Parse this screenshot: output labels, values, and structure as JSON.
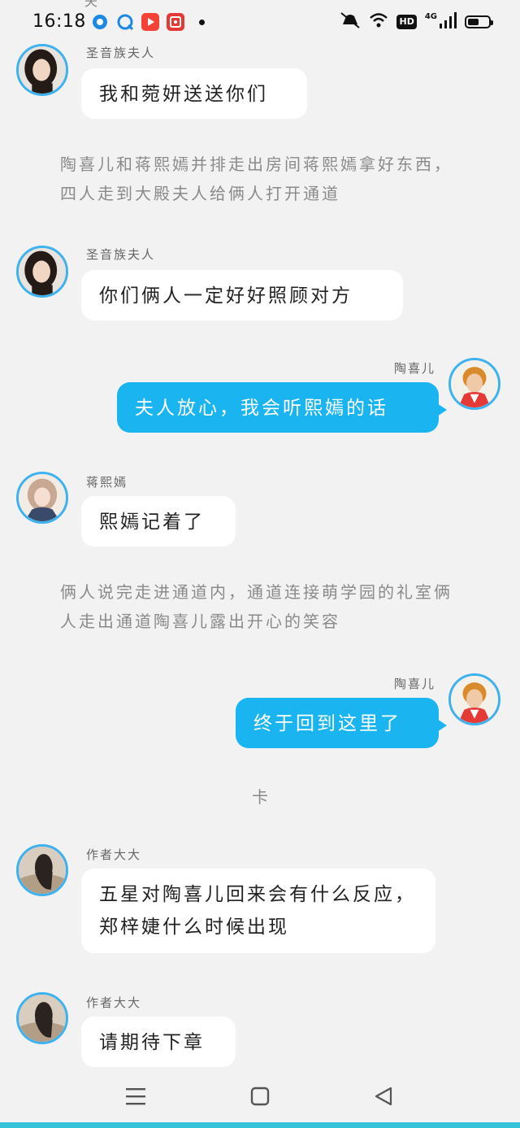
{
  "status_bar": {
    "time": "16:18",
    "hd": "HD",
    "network": "4G",
    "battery_level": 0.55,
    "notification_icons": [
      {
        "name": "app-circle-icon",
        "color": "#1e88e5"
      },
      {
        "name": "app-q-icon",
        "color": "#1e88e5"
      },
      {
        "name": "video-play-icon",
        "color": "#f44336"
      },
      {
        "name": "taobao-icon",
        "color": "#e53935"
      }
    ]
  },
  "top_clipped_text": "夫",
  "messages": [
    {
      "side": "left",
      "sender": "圣音族夫人",
      "text": "我和菀妍送送你们"
    },
    {
      "kind": "narration",
      "text": "陶喜儿和蒋熙嫣并排走出房间蒋熙嫣拿好东西，四人走到大殿夫人给俩人打开通道"
    },
    {
      "side": "left",
      "sender": "圣音族夫人",
      "text": "你们俩人一定好好照顾对方"
    },
    {
      "side": "right",
      "sender": "陶喜儿",
      "text": "夫人放心，我会听熙嫣的话"
    },
    {
      "side": "left",
      "sender": "蒋熙嫣",
      "text": "熙嫣记着了"
    },
    {
      "kind": "narration",
      "text": "俩人说完走进通道内，通道连接萌学园的礼室俩人走出通道陶喜儿露出开心的笑容"
    },
    {
      "side": "right",
      "sender": "陶喜儿",
      "text": "终于回到这里了"
    },
    {
      "kind": "divider",
      "text": "卡"
    },
    {
      "side": "left",
      "sender": "作者大大",
      "text": "五星对陶喜儿回来会有什么反应，郑梓婕什么时候出现"
    },
    {
      "side": "left",
      "sender": "作者大大",
      "text": "请期待下章"
    }
  ],
  "nav": {
    "items": [
      "menu-icon",
      "home-icon",
      "back-icon"
    ]
  },
  "colors": {
    "accent": "#1ab4f0",
    "avatar_ring": "#3db2ee",
    "background": "#f2f2f2",
    "bottom_strip": "#35c2d8"
  }
}
